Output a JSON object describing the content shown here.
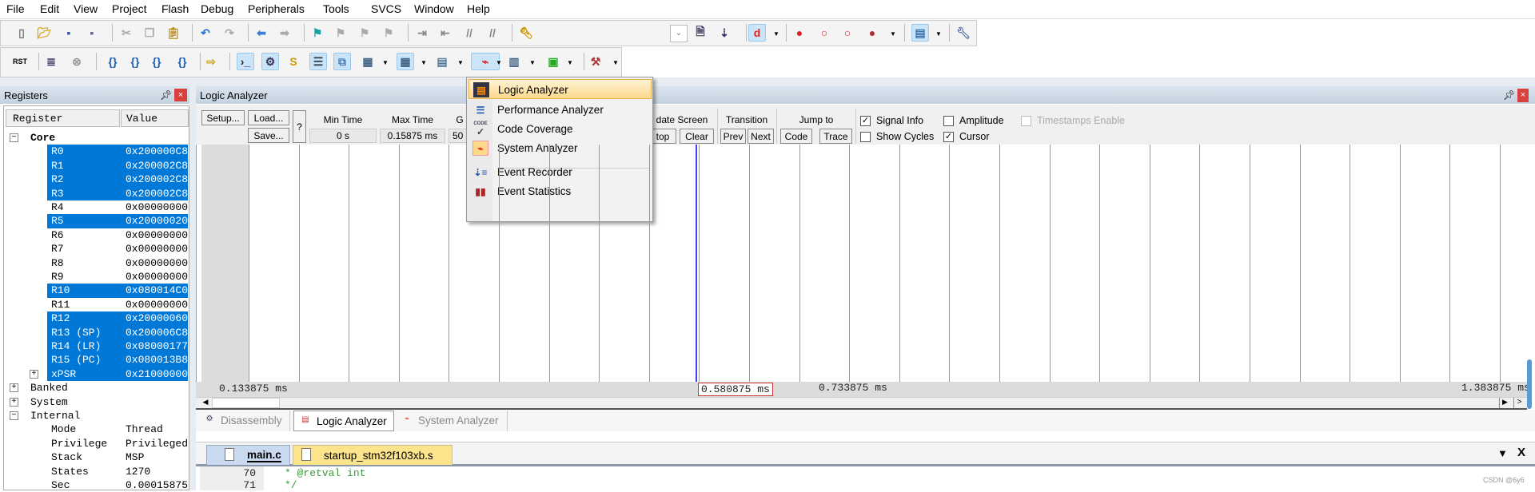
{
  "menu": [
    "File",
    "Edit",
    "View",
    "Project",
    "Flash",
    "Debug",
    "Peripherals",
    "Tools",
    "SVCS",
    "Window",
    "Help"
  ],
  "toolbar1": [
    "new-file-icon",
    "open-file-icon",
    "save-icon",
    "save-all-icon",
    "cut-icon",
    "copy-icon",
    "paste-icon",
    "undo-icon",
    "redo-icon",
    "navigate-back-icon",
    "navigate-forward-icon",
    "bookmark-icon",
    "prev-bookmark-icon",
    "next-bookmark-icon",
    "clear-bookmarks-icon",
    "indent-icon",
    "unindent-icon",
    "comment-icon",
    "uncomment-icon",
    "find-icon",
    "find-in-files-icon",
    "debug-find-icon",
    "start-debug-icon",
    "breakpoint-insert-icon",
    "breakpoint-enable-icon",
    "breakpoint-disable-icon",
    "breakpoint-kill-all-icon",
    "window-layout-icon",
    "configure-icon"
  ],
  "toolbar2": [
    "reset-icon",
    "run-icon",
    "stop-icon",
    "step-into-icon",
    "step-over-icon",
    "step-out-icon",
    "run-to-cursor-icon",
    "show-next-statement-icon",
    "command-window-icon",
    "disassembly-window-icon",
    "symbols-window-icon",
    "registers-window-icon",
    "call-stack-icon",
    "memory-window-icon",
    "serial-window-icon",
    "analysis-window-icon",
    "trace-window-icon",
    "watch-window-icon",
    "system-viewer-icon",
    "toolbox-icon"
  ],
  "rst_label": "RST",
  "registers": {
    "title": "Registers",
    "col_register": "Register",
    "col_value": "Value",
    "rows": [
      {
        "name": "Core",
        "value": "",
        "level": 0,
        "expander": "−",
        "sel": false,
        "bold": true
      },
      {
        "name": "R0",
        "value": "0x200000C8",
        "level": 1,
        "sel": true
      },
      {
        "name": "R1",
        "value": "0x200002C8",
        "level": 1,
        "sel": true
      },
      {
        "name": "R2",
        "value": "0x200002C8",
        "level": 1,
        "sel": true
      },
      {
        "name": "R3",
        "value": "0x200002C8",
        "level": 1,
        "sel": true
      },
      {
        "name": "R4",
        "value": "0x00000000",
        "level": 1,
        "sel": false
      },
      {
        "name": "R5",
        "value": "0x20000020",
        "level": 1,
        "sel": true
      },
      {
        "name": "R6",
        "value": "0x00000000",
        "level": 1,
        "sel": false
      },
      {
        "name": "R7",
        "value": "0x00000000",
        "level": 1,
        "sel": false
      },
      {
        "name": "R8",
        "value": "0x00000000",
        "level": 1,
        "sel": false
      },
      {
        "name": "R9",
        "value": "0x00000000",
        "level": 1,
        "sel": false
      },
      {
        "name": "R10",
        "value": "0x080014C0",
        "level": 1,
        "sel": true
      },
      {
        "name": "R11",
        "value": "0x00000000",
        "level": 1,
        "sel": false
      },
      {
        "name": "R12",
        "value": "0x20000060",
        "level": 1,
        "sel": true
      },
      {
        "name": "R13 (SP)",
        "value": "0x200006C8",
        "level": 1,
        "sel": true
      },
      {
        "name": "R14 (LR)",
        "value": "0x08000177",
        "level": 1,
        "sel": true
      },
      {
        "name": "R15 (PC)",
        "value": "0x080013B8",
        "level": 1,
        "sel": true
      },
      {
        "name": "xPSR",
        "value": "0x21000000",
        "level": 1,
        "expander": "+",
        "sel": true
      },
      {
        "name": "Banked",
        "value": "",
        "level": 0,
        "expander": "+",
        "sel": false
      },
      {
        "name": "System",
        "value": "",
        "level": 0,
        "expander": "+",
        "sel": false
      },
      {
        "name": "Internal",
        "value": "",
        "level": 0,
        "expander": "−",
        "sel": false
      },
      {
        "name": "Mode",
        "value": "Thread",
        "level": 1,
        "sel": false
      },
      {
        "name": "Privilege",
        "value": "Privileged",
        "level": 1,
        "sel": false
      },
      {
        "name": "Stack",
        "value": "MSP",
        "level": 1,
        "sel": false
      },
      {
        "name": "States",
        "value": "1270",
        "level": 1,
        "sel": false
      },
      {
        "name": "Sec",
        "value": "0.00015875",
        "level": 1,
        "sel": false
      }
    ]
  },
  "la": {
    "title": "Logic Analyzer",
    "setup": "Setup...",
    "load": "Load...",
    "save": "Save...",
    "help": "?",
    "min_time_label": "Min Time",
    "min_time": "0 s",
    "max_time_label": "Max Time",
    "max_time": "0.15875 ms",
    "grid_label": "G",
    "grid_value": "50",
    "update_label": "date Screen",
    "stop": "top",
    "clear": "Clear",
    "transition_label": "Transition",
    "prev": "Prev",
    "next": "Next",
    "jump_label": "Jump to",
    "code": "Code",
    "trace": "Trace",
    "signal_info": "Signal Info",
    "signal_info_checked": true,
    "amplitude": "Amplitude",
    "amplitude_checked": false,
    "timestamps": "Timestamps Enable",
    "timestamps_checked": false,
    "show_cycles": "Show Cycles",
    "show_cycles_checked": false,
    "cursor": "Cursor",
    "cursor_checked": true,
    "t_left": "0.133875 ms",
    "t_cursor": "0.580875 ms",
    "t_mid": "0.733875 ms",
    "t_right": "1.383875 ms"
  },
  "dropdown": [
    {
      "label": "Logic Analyzer",
      "icon": "logic-analyzer-icon",
      "active": true
    },
    {
      "label": "Performance Analyzer",
      "icon": "performance-analyzer-icon"
    },
    {
      "label": "Code Coverage",
      "icon": "code-coverage-icon",
      "icon_text": "CODE"
    },
    {
      "label": "System Analyzer",
      "icon": "system-analyzer-icon"
    },
    {
      "label": "Event Recorder",
      "icon": "event-recorder-icon"
    },
    {
      "label": "Event Statistics",
      "icon": "event-statistics-icon"
    }
  ],
  "bottom_tabs": [
    {
      "label": "Disassembly"
    },
    {
      "label": "Logic Analyzer",
      "active": true
    },
    {
      "label": "System Analyzer"
    }
  ],
  "editor": {
    "tabs": [
      {
        "label": "main.c",
        "active": true
      },
      {
        "label": "startup_stm32f103xb.s"
      }
    ],
    "lines": [
      {
        "no": "70",
        "text": "* @retval int"
      },
      {
        "no": "71",
        "text": "*/"
      }
    ]
  },
  "watermark": "CSDN @6y6",
  "colors": {
    "selection": "#0078d7",
    "menu_highlight": "#fde4a8",
    "cursor_line": "#4040ff",
    "startup_tab": "#fce48c"
  }
}
